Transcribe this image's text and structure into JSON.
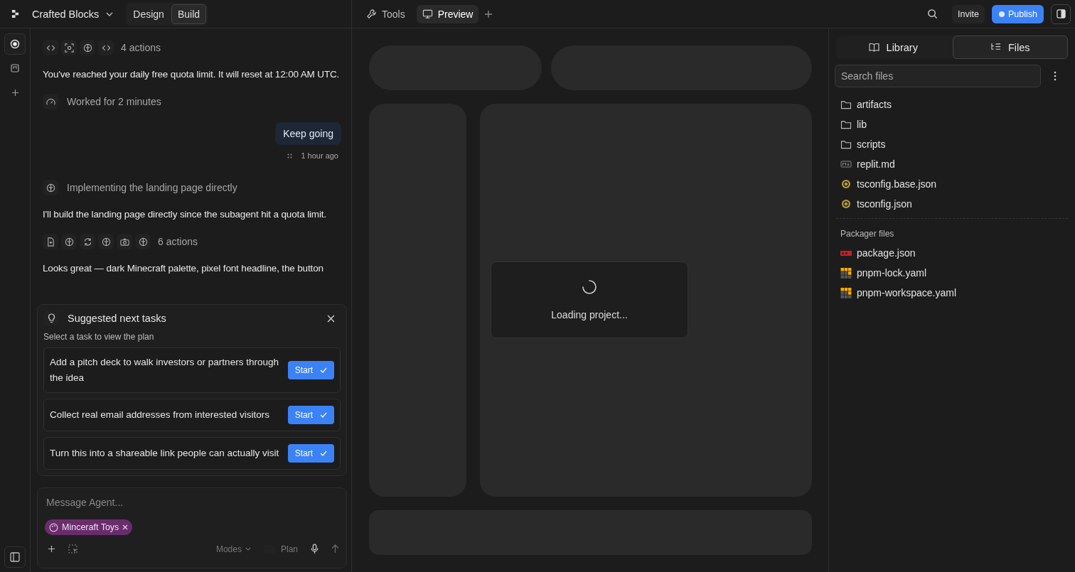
{
  "header": {
    "project": "Crafted Blocks",
    "modes": [
      {
        "label": "Design",
        "selected": false
      },
      {
        "label": "Build",
        "selected": true
      }
    ],
    "tabs": [
      {
        "label": "Tools",
        "kind": "wrench",
        "selected": false
      },
      {
        "label": "Preview",
        "kind": "monitor",
        "selected": true
      }
    ],
    "invite": "Invite",
    "publish": "Publish"
  },
  "chat": [
    {
      "kind": "actions",
      "text": "4 actions"
    },
    {
      "kind": "message",
      "text": "You've reached your daily free quota limit. It will reset at 12:00 AM UTC."
    },
    {
      "kind": "status",
      "text": "Worked for 2 minutes"
    },
    {
      "kind": "user",
      "text": "Keep going",
      "time": "1 hour ago"
    },
    {
      "kind": "status",
      "text": "Implementing the landing page directly"
    },
    {
      "kind": "message",
      "text": "I'll build the landing page directly since the subagent hit a quota limit."
    },
    {
      "kind": "actions",
      "text": "6 actions"
    },
    {
      "kind": "message",
      "text": "Looks great — dark Minecraft palette, pixel font headline, the button"
    }
  ],
  "suggestions": {
    "title": "Suggested next tasks",
    "hint": "Select a task to view the plan",
    "tasks": [
      {
        "text": "Add a pitch deck to walk investors or partners through the idea",
        "button": "Start"
      },
      {
        "text": "Collect real email addresses from interested visitors",
        "button": "Start"
      },
      {
        "text": "Turn this into a shareable link people can actually visit",
        "button": "Start"
      }
    ]
  },
  "composer": {
    "placeholder": "Message Agent...",
    "chip": "Minceraft Toys",
    "modes": "Modes",
    "plan": "Plan"
  },
  "preview": {
    "loading": "Loading project..."
  },
  "files": {
    "tabs": [
      {
        "label": "Library",
        "kind": "book",
        "selected": false
      },
      {
        "label": "Files",
        "kind": "tree",
        "selected": true
      }
    ],
    "search": {
      "placeholder": "Search files"
    },
    "items": [
      {
        "name": "artifacts",
        "kind": "folder"
      },
      {
        "name": "lib",
        "kind": "folder"
      },
      {
        "name": "scripts",
        "kind": "folder"
      },
      {
        "name": "replit.md",
        "kind": "markdown"
      },
      {
        "name": "tsconfig.base.json",
        "kind": "tsconfig"
      },
      {
        "name": "tsconfig.json",
        "kind": "tsconfig"
      }
    ],
    "packager_title": "Packager files",
    "packager": [
      {
        "name": "package.json",
        "kind": "npm"
      },
      {
        "name": "pnpm-lock.yaml",
        "kind": "pnpm"
      },
      {
        "name": "pnpm-workspace.yaml",
        "kind": "pnpm"
      }
    ]
  }
}
